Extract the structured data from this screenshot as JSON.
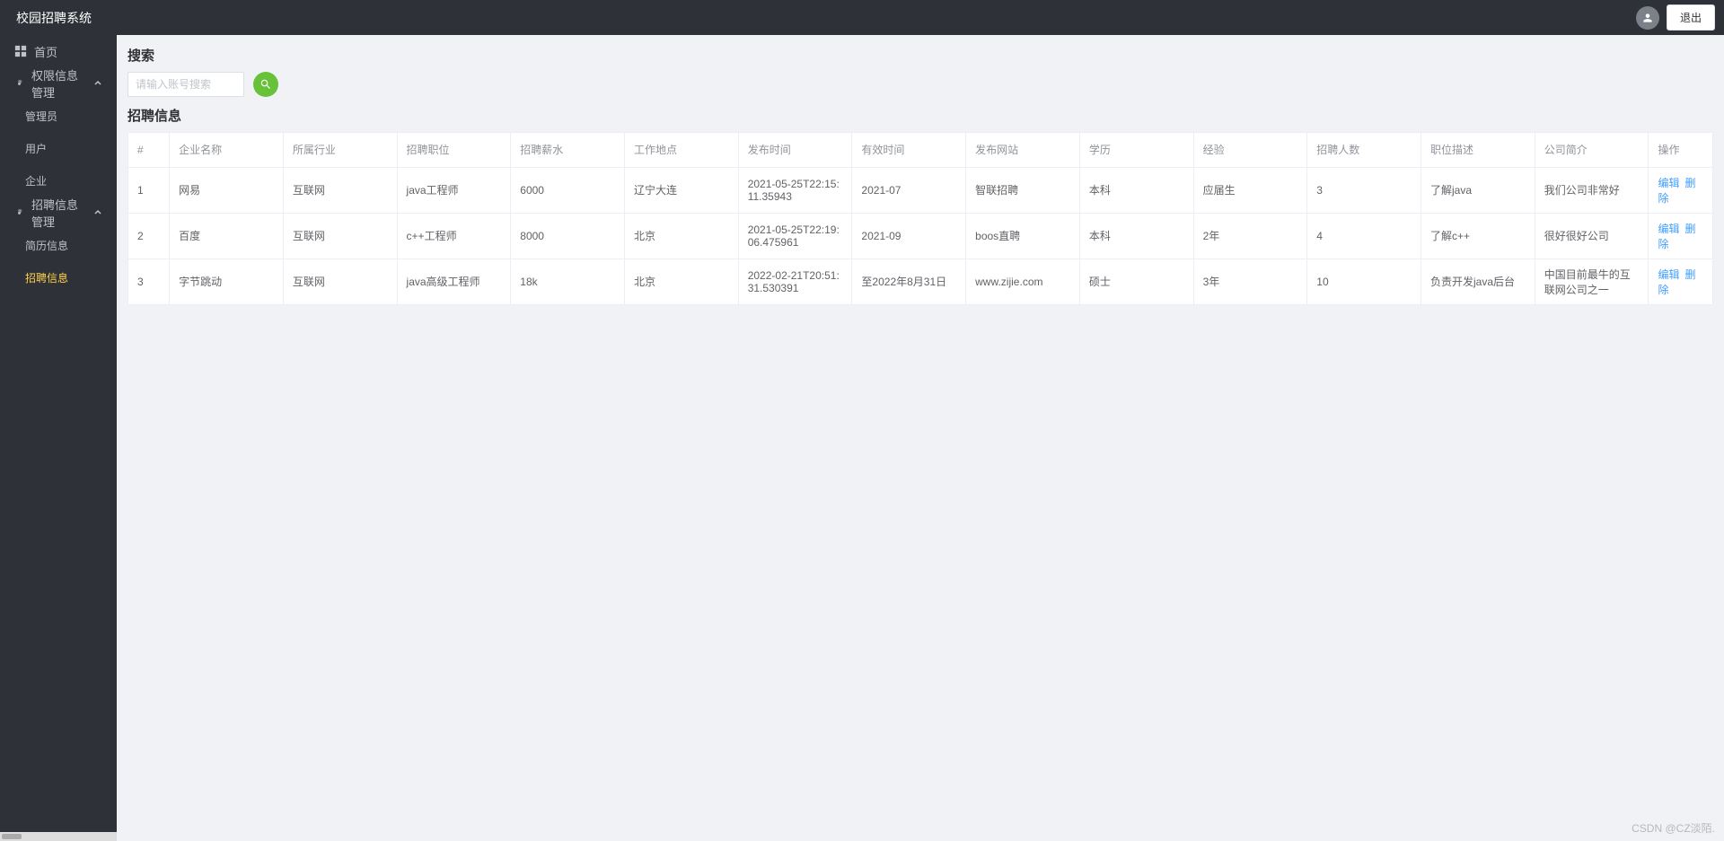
{
  "header": {
    "title": "校园招聘系统",
    "logout": "退出"
  },
  "sidebar": {
    "home": "首页",
    "perm_group": "权限信息管理",
    "perm_admin": "管理员",
    "perm_user": "用户",
    "perm_company": "企业",
    "recruit_group": "招聘信息管理",
    "resume_info": "简历信息",
    "recruit_info": "招聘信息"
  },
  "main": {
    "search_title": "搜索",
    "search_placeholder": "请输入账号搜索",
    "info_title": "招聘信息"
  },
  "table": {
    "headers": {
      "idx": "#",
      "company": "企业名称",
      "industry": "所属行业",
      "position": "招聘职位",
      "salary": "招聘薪水",
      "location": "工作地点",
      "pubtime": "发布时间",
      "validtime": "有效时间",
      "website": "发布网站",
      "edu": "学历",
      "exp": "经验",
      "count": "招聘人数",
      "desc": "职位描述",
      "intro": "公司简介",
      "op": "操作"
    },
    "op_edit": "编辑",
    "op_delete": "删除",
    "rows": [
      {
        "idx": "1",
        "company": "网易",
        "industry": "互联网",
        "position": "java工程师",
        "salary": "6000",
        "location": "辽宁大连",
        "pubtime": "2021-05-25T22:15:11.35943",
        "validtime": "2021-07",
        "website": "智联招聘",
        "edu": "本科",
        "exp": "应届生",
        "count": "3",
        "desc": "了解java",
        "intro": "我们公司非常好"
      },
      {
        "idx": "2",
        "company": "百度",
        "industry": "互联网",
        "position": "c++工程师",
        "salary": "8000",
        "location": "北京",
        "pubtime": "2021-05-25T22:19:06.475961",
        "validtime": "2021-09",
        "website": "boos直聘",
        "edu": "本科",
        "exp": "2年",
        "count": "4",
        "desc": "了解c++",
        "intro": "很好很好公司"
      },
      {
        "idx": "3",
        "company": "字节跳动",
        "industry": "互联网",
        "position": "java高级工程师",
        "salary": "18k",
        "location": "北京",
        "pubtime": "2022-02-21T20:51:31.530391",
        "validtime": "至2022年8月31日",
        "website": "www.zijie.com",
        "edu": "硕士",
        "exp": "3年",
        "count": "10",
        "desc": "负责开发java后台",
        "intro": "中国目前最牛的互联网公司之一"
      }
    ]
  },
  "watermark": "CSDN @CZ淡陌."
}
